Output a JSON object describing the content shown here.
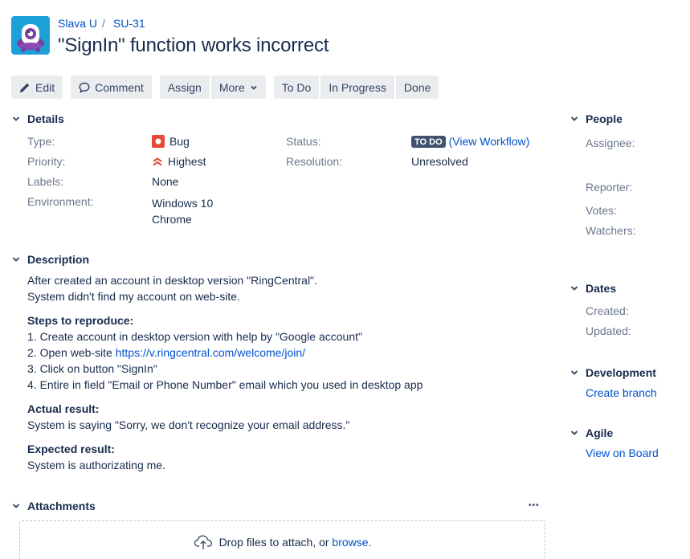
{
  "breadcrumb": {
    "project": "Slava U",
    "separator": "/",
    "issue_key": "SU-31"
  },
  "issue": {
    "title": "\"SignIn\" function works incorrect"
  },
  "toolbar": {
    "edit": "Edit",
    "comment": "Comment",
    "assign": "Assign",
    "more": "More",
    "todo": "To Do",
    "in_progress": "In Progress",
    "done": "Done"
  },
  "details": {
    "heading": "Details",
    "type_label": "Type:",
    "type_value": "Bug",
    "priority_label": "Priority:",
    "priority_value": "Highest",
    "labels_label": "Labels:",
    "labels_value": "None",
    "environment_label": "Environment:",
    "environment_line1": "Windows 10",
    "environment_line2": "Chrome",
    "status_label": "Status:",
    "status_value": "TO DO",
    "view_workflow": "(View Workflow)",
    "resolution_label": "Resolution:",
    "resolution_value": "Unresolved"
  },
  "description": {
    "heading": "Description",
    "line1": "After created an account in desktop version \"RingCentral\".",
    "line2": "System didn't find my account on web-site.",
    "steps_heading": "Steps to reproduce:",
    "step1": "1. Create account in desktop version with help by \"Google account\"",
    "step2_prefix": "2. Open web-site ",
    "step2_link": "https://v.ringcentral.com/welcome/join/",
    "step3": "3. Click on button \"SignIn\"",
    "step4": "4. Entire in field \"Email or Phone Number\" email which you used in desktop app",
    "actual_heading": "Actual result:",
    "actual_text": "System is saying \"Sorry, we don't recognize your email address.\"",
    "expected_heading": "Expected result:",
    "expected_text": "System is authorizating me."
  },
  "attachments": {
    "heading": "Attachments",
    "more": "•••",
    "drop_text": "Drop files to attach, or ",
    "browse": "browse."
  },
  "people": {
    "heading": "People",
    "assignee": "Assignee:",
    "reporter": "Reporter:",
    "votes": "Votes:",
    "watchers": "Watchers:"
  },
  "dates": {
    "heading": "Dates",
    "created": "Created:",
    "updated": "Updated:"
  },
  "development": {
    "heading": "Development",
    "create_branch": "Create branch"
  },
  "agile": {
    "heading": "Agile",
    "view_on_board": "View on Board"
  },
  "colors": {
    "link": "#0052cc",
    "bug": "#e5493a",
    "priority": "#e5493a",
    "lozenge": "#42526e",
    "avatar": "#1ba1d8"
  }
}
